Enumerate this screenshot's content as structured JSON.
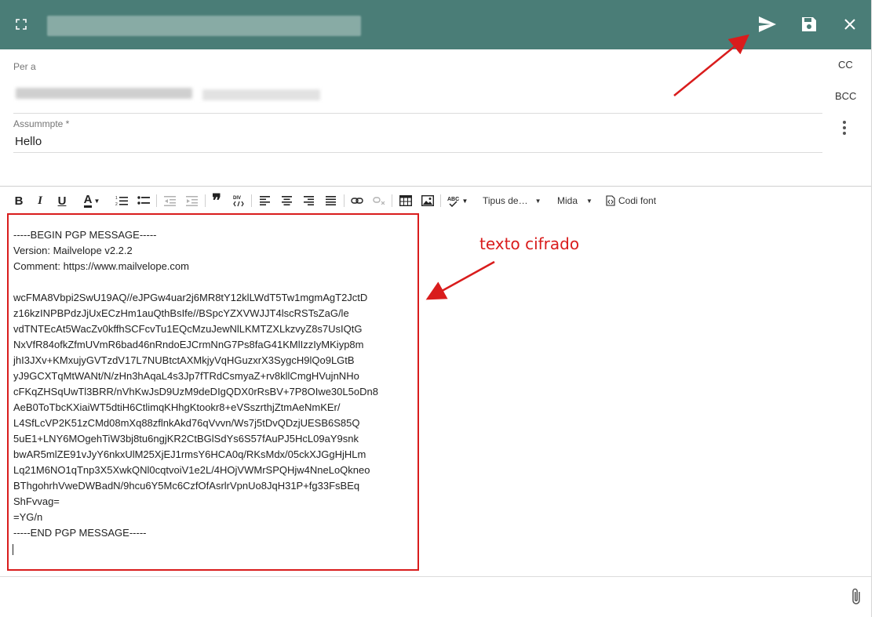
{
  "compose": {
    "header_icons": {
      "expand": "fullscreen-icon",
      "send": "send-icon",
      "save": "save-icon",
      "close": "close-icon"
    },
    "to_label": "Per a",
    "subject_label": "Assummpte *",
    "subject_value": "Hello",
    "cc_label": "CC",
    "bcc_label": "BCC",
    "more_icon": "more-vert-icon"
  },
  "toolbar": {
    "bold": "B",
    "italic": "I",
    "underline": "U",
    "font_color": "A",
    "font_type": "Tipus de…",
    "font_size": "Mida",
    "source_code": "Codi font"
  },
  "message_lines": [
    "-----BEGIN PGP MESSAGE-----",
    "Version: Mailvelope v2.2.2",
    "Comment: https://www.mailvelope.com",
    "",
    "wcFMA8Vbpi2SwU19AQ//eJPGw4uar2j6MR8tY12klLWdT5Tw1mgmAgT2JctD",
    "z16kzINPBPdzJjUxECzHm1auQthBsIfe//BSpcYZXVWJJT4lscRSTsZaG/le",
    "vdTNTEcAt5WacZv0kffhSCFcvTu1EQcMzuJewNlLKMTZXLkzvyZ8s7UsIQtG",
    "NxVfR84ofkZfmUVmR6bad46nRndoEJCrmNnG7Ps8faG41KMlIzzIyMKiyp8m",
    "jhI3JXv+KMxujyGVTzdV17L7NUBtctAXMkjyVqHGuzxrX3SygcH9lQo9LGtB",
    "yJ9GCXTqMtWANt/N/zHn3hAqaL4s3Jp7fTRdCsmyaZ+rv8kllCmgHVujnNHo",
    "cFKqZHSqUwTl3BRR/nVhKwJsD9UzM9deDIgQDX0rRsBV+7P8OIwe30L5oDn8",
    "AeB0ToTbcKXiaiWT5dtiH6CtlimqKHhgKtookr8+eVSszrthjZtmAeNmKEr/",
    "L4SfLcVP2K51zCMd08mXq88zflnkAkd76qVvvn/Ws7j5tDvQDzjUESB6S85Q",
    "5uE1+LNY6MOgehTiW3bj8tu6ngjKR2CtBGlSdYs6S57fAuPJ5HcL09aY9snk",
    "bwAR5mlZE91vJyY6nkxUlM25XjEJ1rmsY6HCA0q/RKsMdx/05ckXJGgHjHLm",
    "Lq21M6NO1qTnp3X5XwkQNl0cqtvoiV1e2L/4HOjVWMrSPQHjw4NneLoQkneo",
    "BThgohrhVweDWBadN/9hcu6Y5Mc6CzfOfAsrlrVpnUo8JqH31P+fg33FsBEq",
    "ShFvvag=",
    "=YG/n",
    "-----END PGP MESSAGE-----"
  ],
  "annotation": {
    "text": "texto cifrado",
    "color": "#d91c1c"
  },
  "footer": {
    "attach_icon": "paperclip-icon"
  },
  "colors": {
    "header": "#4a7d77",
    "annotation": "#d91c1c"
  }
}
